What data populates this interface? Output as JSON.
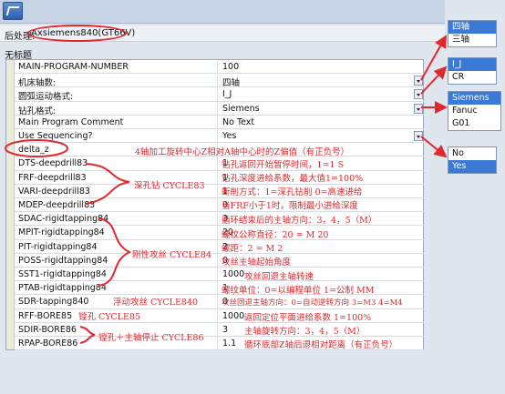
{
  "window": {
    "post_label": "后处理:",
    "post_value": "Axsiemens840(GT66V)",
    "untitled": "无标题"
  },
  "grid": {
    "rows": [
      {
        "key": "MAIN-PROGRAM-NUMBER",
        "value": "100"
      },
      {
        "key": "机床轴数:",
        "value": "四轴",
        "dropdown": true
      },
      {
        "key": "圆弧运动格式:",
        "value": "I_J",
        "dropdown": true
      },
      {
        "key": "钻孔格式:",
        "value": "Siemens",
        "dropdown": true
      },
      {
        "key": "Main Program Comment",
        "value": "No Text"
      },
      {
        "key": "Use Sequencing?",
        "value": "Yes",
        "dropdown": true
      },
      {
        "key": "delta_z",
        "value": ""
      },
      {
        "key": "DTS-deepdrill83",
        "value": "1"
      },
      {
        "key": "FRF-deepdrill83",
        "value": "1"
      },
      {
        "key": "VARI-deepdrill83",
        "value": "1"
      },
      {
        "key": "MDEP-deepdrill83",
        "value": "0"
      },
      {
        "key": "SDAC-rigidtapping84",
        "value": "3"
      },
      {
        "key": "MPIT-rigidtapping84",
        "value": "20"
      },
      {
        "key": "PIT-rigidtapping84",
        "value": "2"
      },
      {
        "key": "POSS-rigidtapping84",
        "value": "0"
      },
      {
        "key": "SST1-rigidtapping84",
        "value": "1000"
      },
      {
        "key": "PTAB-rigidtapping84",
        "value": "1"
      },
      {
        "key": "SDR-tapping840",
        "value": "0"
      },
      {
        "key": "RFF-BORE85",
        "value": "1000"
      },
      {
        "key": "SDIR-BORE86",
        "value": "3"
      },
      {
        "key": "RPAP-BORE86",
        "value": "1.1"
      }
    ]
  },
  "annotations": {
    "delta_z": "4轴加工旋转中心Z相对A轴中心时的Z偏值（有正负号）",
    "dts": "钻孔返回开始暂停时间，1=1 S",
    "frf": "钻孔深度进给系数，最大值1=100%",
    "vari": "断削方式：1=深孔钻削    0=高速进给",
    "mdep": "当FRF小于1时，限制最小进给深度",
    "deep_drill": "深孔钻 CYCLE83",
    "sdac": "循环结束后的主轴方向：3，4，5（M）",
    "mpit": "螺纹公称直径：20 = M 20",
    "pit": "螺距：2 = M 2",
    "rigid_tap": "刚性攻丝 CYCLE84",
    "poss": "攻丝主轴起始角度",
    "sst1": "攻丝回退主轴转速",
    "ptab": "螺纹单位：0=以编程单位    1=公制 MM",
    "float_tap": "浮动攻丝 CYCLE840",
    "sdr": "攻丝回退主轴方向：0=自动逆转方向 3=M3   4=M4",
    "bore85": "镗孔 CYCLE85",
    "rff": "返回定位平面进给系数    1=100%",
    "sdir": "主轴旋转方向：3，4，5（M）",
    "bore86": "镗孔＋主轴停止 CYCLE86",
    "rpap": "循环底部Z轴后退相对距离（有正负号）"
  },
  "popups": {
    "axes": {
      "items": [
        "四轴",
        "三轴"
      ],
      "selected": 0
    },
    "arc": {
      "items": [
        "I_J",
        "CR"
      ],
      "selected": 0
    },
    "drill": {
      "items": [
        "Siemens",
        "Fanuc",
        "G01"
      ],
      "selected": 0
    },
    "seq": {
      "items": [
        "No",
        "Yes"
      ],
      "selected": 1
    }
  },
  "colors": {
    "annotation": "#e0282e",
    "highlight": "#3b79d6"
  }
}
